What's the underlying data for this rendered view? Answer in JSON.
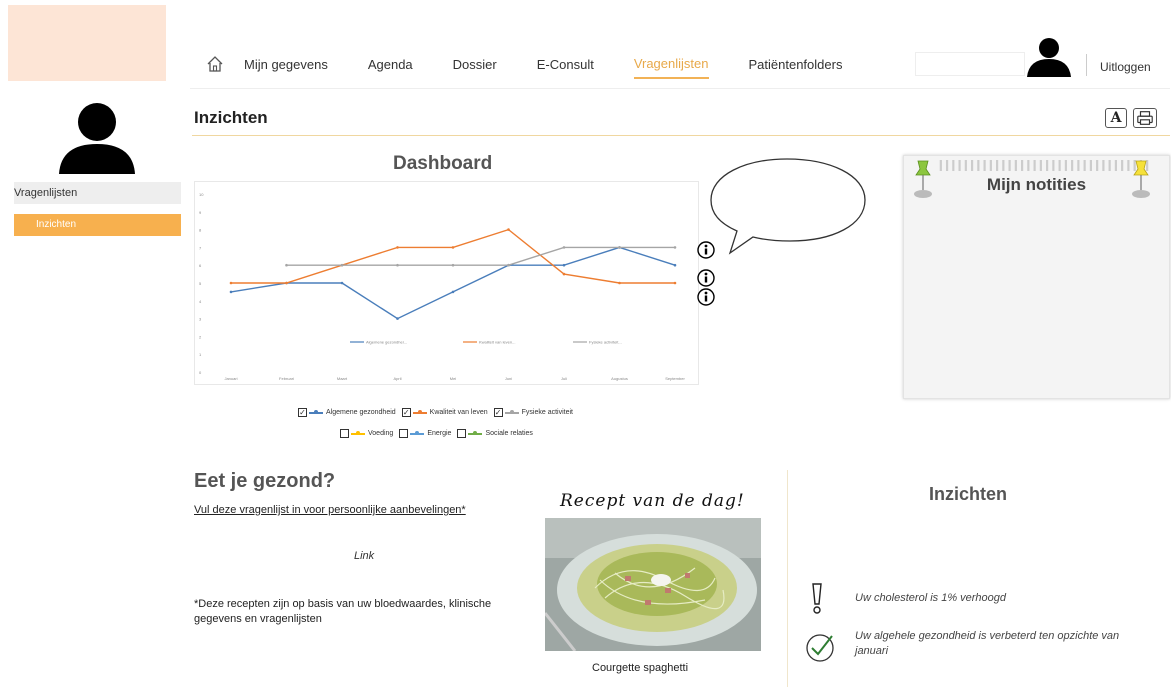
{
  "nav": {
    "items": [
      "Mijn gegevens",
      "Agenda",
      "Dossier",
      "E-Consult",
      "Vragenlijsten",
      "Patiëntenfolders"
    ],
    "active": "Vragenlijsten",
    "logout": "Uitloggen"
  },
  "sidebar": {
    "items": [
      "Vragenlijsten",
      "Inzichten"
    ],
    "active": "Inzichten"
  },
  "page": {
    "title": "Inzichten",
    "font_button": "A"
  },
  "dashboard": {
    "title": "Dashboard",
    "legend_rows": [
      [
        {
          "label": "Algemene gezondheid",
          "checked": true,
          "color": "#4a7ebb"
        },
        {
          "label": "Kwaliteit van leven",
          "checked": true,
          "color": "#ed7d31"
        },
        {
          "label": "Fysieke activiteit",
          "checked": true,
          "color": "#a5a5a5"
        }
      ],
      [
        {
          "label": "Voeding",
          "checked": false,
          "color": "#ffc000"
        },
        {
          "label": "Energie",
          "checked": false,
          "color": "#5b9bd5"
        },
        {
          "label": "Sociale relaties",
          "checked": false,
          "color": "#70ad47"
        }
      ]
    ]
  },
  "chart_data": {
    "type": "line",
    "categories": [
      "Januari",
      "Februari",
      "Maart",
      "April",
      "Mei",
      "Juni",
      "Juli",
      "Augustus",
      "September"
    ],
    "ylim": [
      0,
      10
    ],
    "grid": false,
    "legend_position": "bottom",
    "series": [
      {
        "name": "Algemene gezondhei...",
        "color": "#4a7ebb",
        "values": [
          4.5,
          5,
          5,
          3,
          4.5,
          6,
          6,
          7,
          6
        ]
      },
      {
        "name": "Kwaliteit van leven...",
        "color": "#ed7d31",
        "values": [
          5,
          5,
          6,
          7,
          7,
          8,
          5.5,
          5,
          5
        ]
      },
      {
        "name": "Fysieke activiteit...",
        "color": "#a5a5a5",
        "values": [
          null,
          6,
          6,
          6,
          6,
          6,
          7,
          7,
          7
        ]
      }
    ]
  },
  "notes": {
    "title": "Mijn notities"
  },
  "eat": {
    "title": "Eet je gezond?",
    "link": "Vul deze vragenlijst in voor persoonlijke aanbevelingen*",
    "link_text": "Link",
    "footnote": "*Deze recepten zijn op basis van uw bloedwaardes, klinische gegevens en vragenlijsten"
  },
  "recipe": {
    "title": "Recept van de dag!",
    "caption": "Courgette spaghetti"
  },
  "insights": {
    "title": "Inzichten",
    "items": [
      {
        "icon": "exclamation-icon",
        "text": "Uw cholesterol is 1% verhoogd"
      },
      {
        "icon": "checkmark-icon",
        "text": "Uw algehele gezondheid is verbeterd ten opzichte van januari"
      }
    ]
  }
}
